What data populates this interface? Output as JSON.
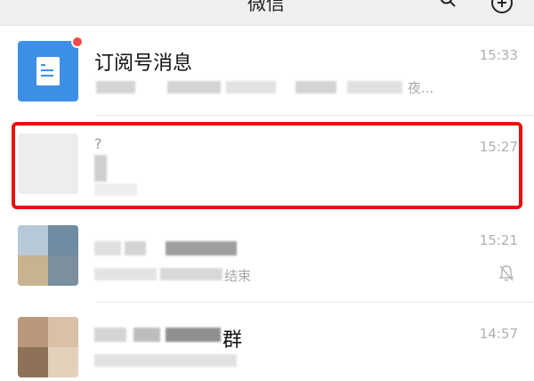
{
  "header": {
    "title": "微信",
    "search_icon": "search-icon",
    "add_icon": "add-circle-icon"
  },
  "chats": [
    {
      "name": "订阅号消息",
      "time": "15:33",
      "preview": "夜...",
      "unread_dot": true,
      "avatar_icon": "document-icon",
      "accent": "#3d8fe6"
    },
    {
      "name": "?",
      "time": "15:27",
      "preview": "",
      "highlighted": true,
      "highlight_color": "#e81010"
    },
    {
      "name": "",
      "time": "15:21",
      "preview": "结束",
      "muted": true
    },
    {
      "name": "群",
      "time": "14:57",
      "preview": ""
    }
  ]
}
